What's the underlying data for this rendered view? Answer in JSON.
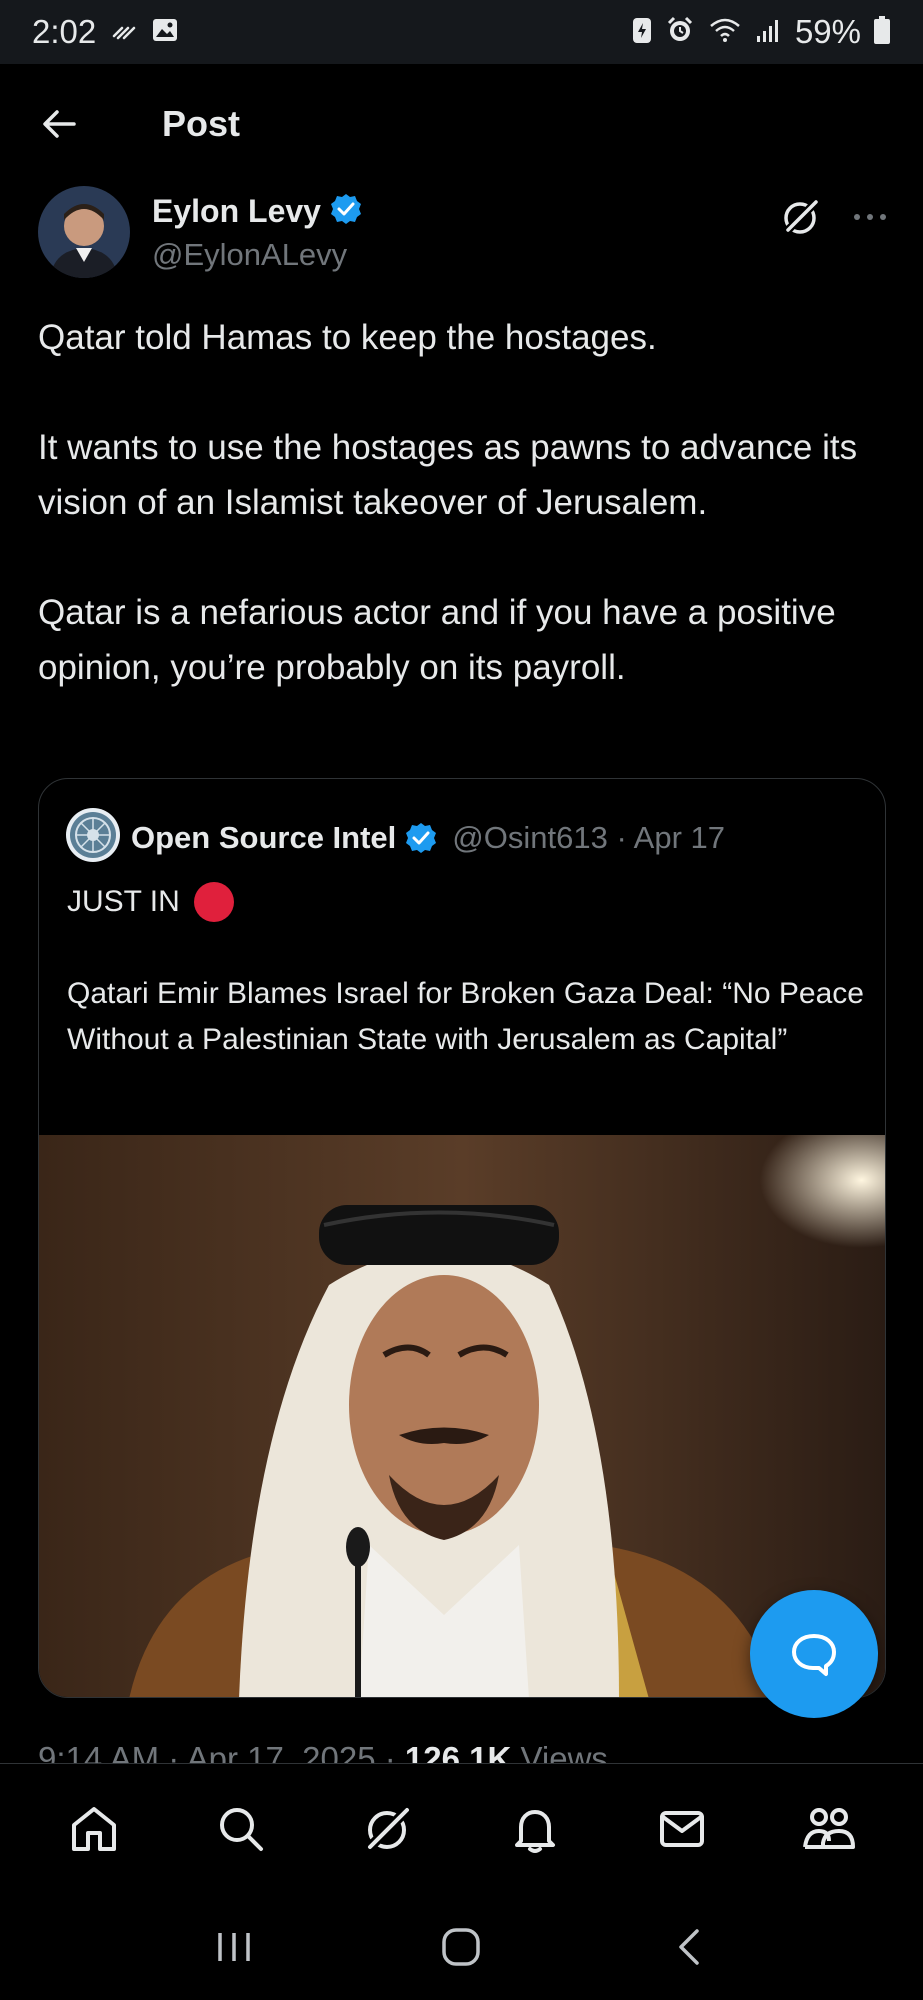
{
  "status_bar": {
    "time": "2:02",
    "battery_percent": "59%",
    "icons": [
      "signal-wave-icon",
      "image-icon",
      "battery-saver-icon",
      "alarm-icon",
      "wifi-icon",
      "cell-signal-icon",
      "battery-icon"
    ]
  },
  "header": {
    "title": "Post"
  },
  "post": {
    "author_name": "Eylon Levy",
    "author_handle": "@EylonALevy",
    "paragraphs": [
      "Qatar told Hamas to keep the hostages.",
      "It wants to use the hostages as pawns to advance its vision of an Islamist takeover of Jerusalem.",
      "Qatar is a nefarious actor and if you have a positive opinion, you’re probably on its payroll."
    ],
    "timestamp_prefix": "9:14 AM · Apr 17, 2025 · ",
    "views_count": "126.1K",
    "views_label": " Views"
  },
  "quote": {
    "author_name": "Open Source Intel",
    "author_handle": "@Osint613",
    "separator": " · ",
    "date": "Apr 17",
    "line1": "JUST IN",
    "body": "Qatari Emir Blames Israel for Broken Gaza Deal: “No Peace Without a Palestinian State with Jerusalem as Capital”"
  },
  "colors": {
    "accent": "#1d9bf0",
    "text_primary": "#e7e9ea",
    "text_secondary": "#71767b",
    "border": "#2f3336",
    "red_dot": "#e0203c"
  },
  "nav": {
    "items": [
      "home-icon",
      "search-icon",
      "grok-icon",
      "notifications-icon",
      "messages-icon",
      "communities-icon"
    ]
  }
}
